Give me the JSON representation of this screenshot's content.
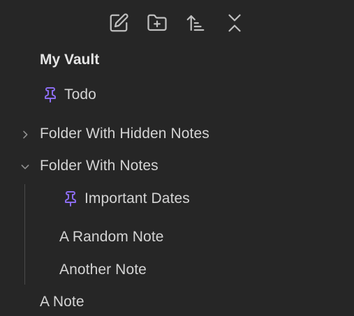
{
  "toolbar": {
    "new_note_icon": "new-note-icon",
    "new_folder_icon": "new-folder-icon",
    "sort_icon": "sort-icon",
    "collapse_icon": "collapse-all-icon"
  },
  "vault": {
    "name": "My Vault"
  },
  "tree": {
    "pinned_root": {
      "label": "Todo",
      "icon": "pin-icon"
    },
    "folder_hidden": {
      "label": "Folder With Hidden Notes",
      "state": "collapsed"
    },
    "folder_notes": {
      "label": "Folder With Notes",
      "state": "expanded",
      "children": [
        {
          "label": "Important Dates",
          "pinned": true
        },
        {
          "label": "A Random Note",
          "pinned": false
        },
        {
          "label": "Another Note",
          "pinned": false
        }
      ]
    },
    "root_note": {
      "label": "A Note"
    }
  },
  "colors": {
    "background": "#262626",
    "text": "#d4d4d4",
    "accent_pin": "#8b6cef",
    "icon": "#bfbfbf"
  }
}
